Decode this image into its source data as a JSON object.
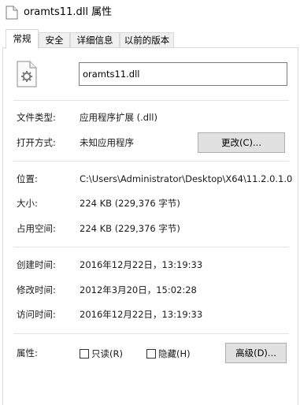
{
  "window": {
    "title": "oramts11.dll 属性"
  },
  "tabs": [
    {
      "label": "常规",
      "active": true
    },
    {
      "label": "安全",
      "active": false
    },
    {
      "label": "详细信息",
      "active": false
    },
    {
      "label": "以前的版本",
      "active": false
    }
  ],
  "general": {
    "file_icon": "dll-file-icon",
    "file_name": "oramts11.dll",
    "file_type_label": "文件类型:",
    "file_type_value": "应用程序扩展 (.dll)",
    "open_with_label": "打开方式:",
    "open_with_value": "未知应用程序",
    "change_button": "更改(C)...",
    "location_label": "位置:",
    "location_value": "C:\\Users\\Administrator\\Desktop\\X64\\11.2.0.1.0",
    "size_label": "大小:",
    "size_value": "224 KB (229,376 字节)",
    "size_on_disk_label": "占用空间:",
    "size_on_disk_value": "224 KB (229,376 字节)",
    "created_label": "创建时间:",
    "created_value": "2016年12月22日，13:19:33",
    "modified_label": "修改时间:",
    "modified_value": "2012年3月20日，15:02:28",
    "accessed_label": "访问时间:",
    "accessed_value": "2016年12月22日，13:19:33",
    "attributes_label": "属性:",
    "readonly_label": "只读(R)",
    "readonly_checked": false,
    "hidden_label": "隐藏(H)",
    "hidden_checked": false,
    "advanced_button": "高级(D)..."
  }
}
